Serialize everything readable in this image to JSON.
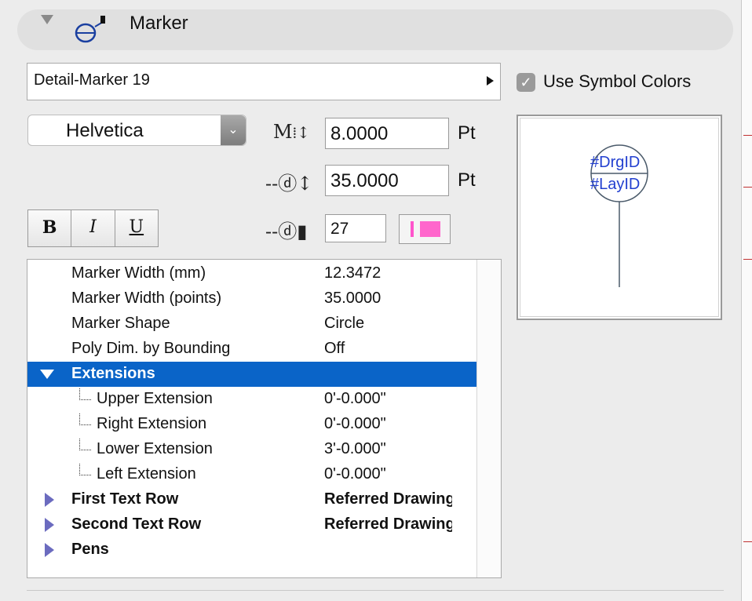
{
  "header": {
    "title": "Marker"
  },
  "marker_popup": {
    "value": "Detail-Marker 19"
  },
  "use_symbol_colors": {
    "label": "Use Symbol Colors",
    "checked": true
  },
  "font": {
    "family": "Helvetica"
  },
  "text_size": {
    "value": "8.0000",
    "unit": "Pt"
  },
  "marker_size": {
    "value": "35.0000",
    "unit": "Pt"
  },
  "marker_pen": {
    "value": "27",
    "color": "#ff66cc"
  },
  "style_buttons": {
    "bold": "B",
    "italic": "I",
    "underline": "U"
  },
  "preview": {
    "line1": "#DrgID",
    "line2": "#LayID",
    "text_color": "#2340d0"
  },
  "settings": {
    "rows": [
      {
        "label": "Marker Width (mm)",
        "value": "12.3472"
      },
      {
        "label": "Marker Width (points)",
        "value": "35.0000"
      },
      {
        "label": "Marker Shape",
        "value": "Circle"
      },
      {
        "label": "Poly Dim. by Bounding",
        "value": "Off"
      },
      {
        "label": "Extensions",
        "value": ""
      },
      {
        "label": "Upper Extension",
        "value": "0'-0.000\""
      },
      {
        "label": "Right Extension",
        "value": "0'-0.000\""
      },
      {
        "label": "Lower Extension",
        "value": "3'-0.000\""
      },
      {
        "label": "Left Extension",
        "value": "0'-0.000\""
      },
      {
        "label": "First Text Row",
        "value": "Referred Drawing"
      },
      {
        "label": "Second Text Row",
        "value": "Referred Drawing"
      },
      {
        "label": "Pens",
        "value": ""
      }
    ]
  },
  "colors": {
    "selection": "#0a64c8",
    "expander": "#6b6bbf"
  }
}
